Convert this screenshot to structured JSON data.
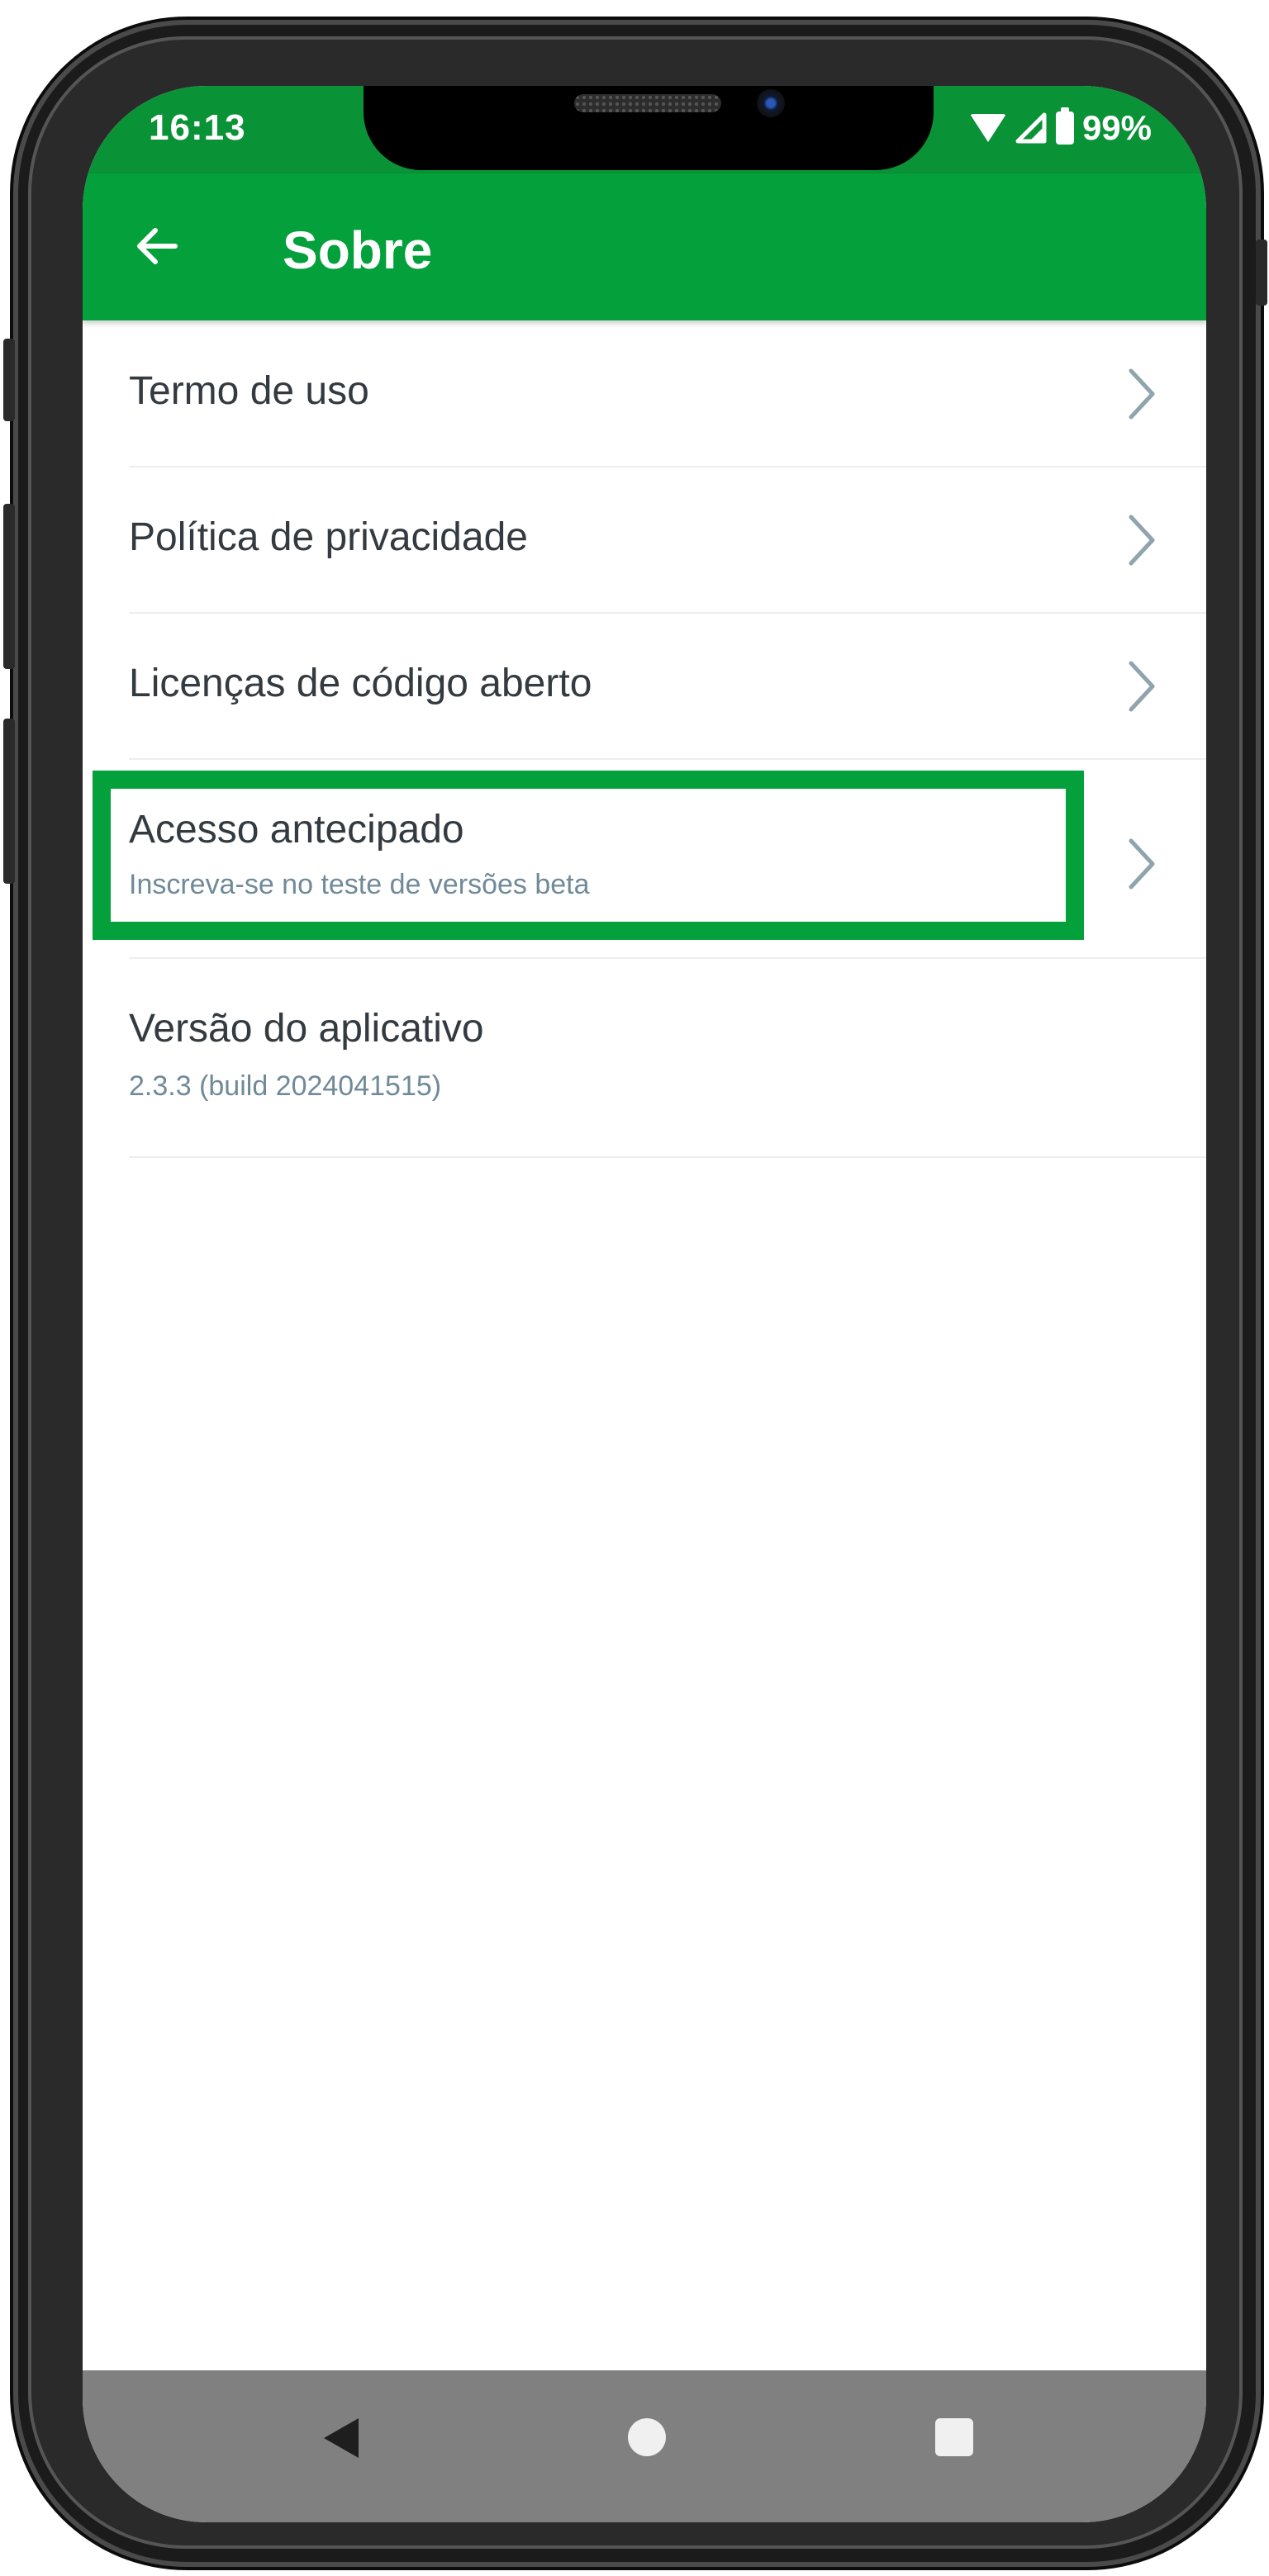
{
  "status_bar": {
    "time": "16:13",
    "battery": "99%"
  },
  "app_bar": {
    "title": "Sobre",
    "back_icon": "arrow-left-icon"
  },
  "menu": {
    "items": [
      {
        "label": "Termo de uso",
        "icon": "chevron-right-icon"
      },
      {
        "label": "Política de privacidade",
        "icon": "chevron-right-icon"
      },
      {
        "label": "Licenças de código aberto",
        "icon": "chevron-right-icon"
      },
      {
        "label": "Acesso antecipado",
        "subtitle": "Inscreva-se no teste de versões beta",
        "icon": "chevron-right-icon",
        "highlighted": true
      },
      {
        "label": "Versão do aplicativo",
        "subtitle": "2.3.3 (build 2024041515)"
      }
    ]
  },
  "nav_bar": {
    "back_icon": "triangle-back-icon",
    "home_icon": "circle-home-icon",
    "recents_icon": "square-recents-icon"
  },
  "colors": {
    "app_bar": "#03A03B",
    "status_bar": "#0A9236",
    "highlight": "#03A03B",
    "label_text": "#333A40",
    "subtitle_text": "#708A99",
    "nav_bar": "#808080"
  }
}
